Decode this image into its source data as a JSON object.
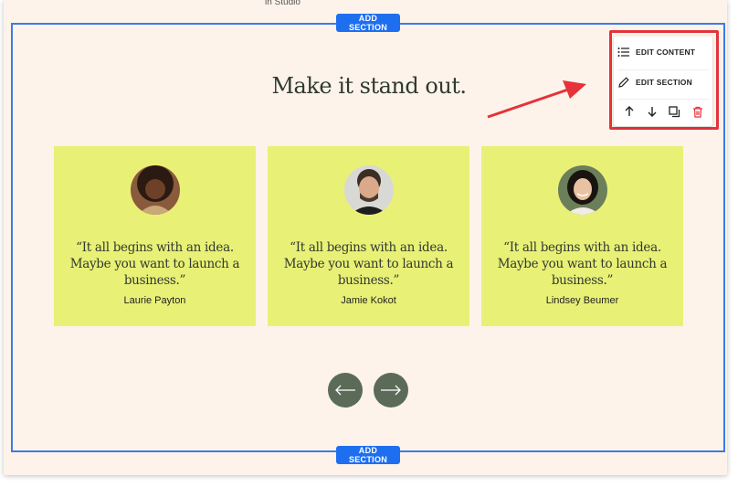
{
  "top_cut_text": "in Studio",
  "add_section_label": "ADD SECTION",
  "heading": "Make it stand out.",
  "cards": [
    {
      "quote": "“It all begins with an idea. Maybe you want to launch a business.”",
      "author": "Laurie Payton"
    },
    {
      "quote": "“It all begins with an idea. Maybe you want to launch a business.”",
      "author": "Jamie Kokot"
    },
    {
      "quote": "“It all begins with an idea. Maybe you want to launch a business.”",
      "author": "Lindsey Beumer"
    }
  ],
  "toolbar": {
    "edit_content": "EDIT CONTENT",
    "edit_section": "EDIT SECTION",
    "icons": [
      "arrow-up-icon",
      "arrow-down-icon",
      "duplicate-icon",
      "trash-icon"
    ]
  },
  "colors": {
    "page_bg": "#fdf3ea",
    "card_bg": "#e9f076",
    "accent_blue": "#1e6ff0",
    "nav_button": "#5b6b57",
    "highlight_red": "#e5323b"
  }
}
